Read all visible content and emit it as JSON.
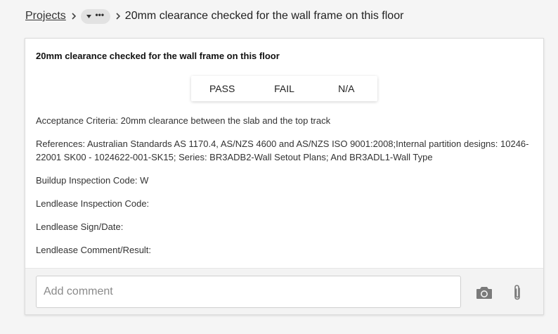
{
  "breadcrumb": {
    "root": "Projects",
    "ellipsis": "•••",
    "current": "20mm clearance checked for the wall frame on this floor"
  },
  "card": {
    "title": "20mm clearance checked for the wall frame on this floor",
    "options": [
      "PASS",
      "FAIL",
      "N/A"
    ],
    "acceptance_criteria": "Acceptance Criteria: 20mm clearance between the slab and the top track",
    "references": "References: Australian Standards AS 1170.4, AS/NZS 4600 and AS/NZS ISO 9001:2008;Internal partition designs: 10246-22001 SK00 - 1024622-001-SK15; Series: BR3ADB2-Wall Setout Plans; And BR3ADL1-Wall Type",
    "buildup_code": "Buildup Inspection Code: W",
    "lendlease_code": "Lendlease Inspection Code:",
    "lendlease_sign": "Lendlease Sign/Date:",
    "lendlease_comment": "Lendlease Comment/Result:"
  },
  "comment": {
    "placeholder": "Add comment"
  },
  "icons": {
    "camera": "camera-icon",
    "attach": "paperclip-icon"
  }
}
